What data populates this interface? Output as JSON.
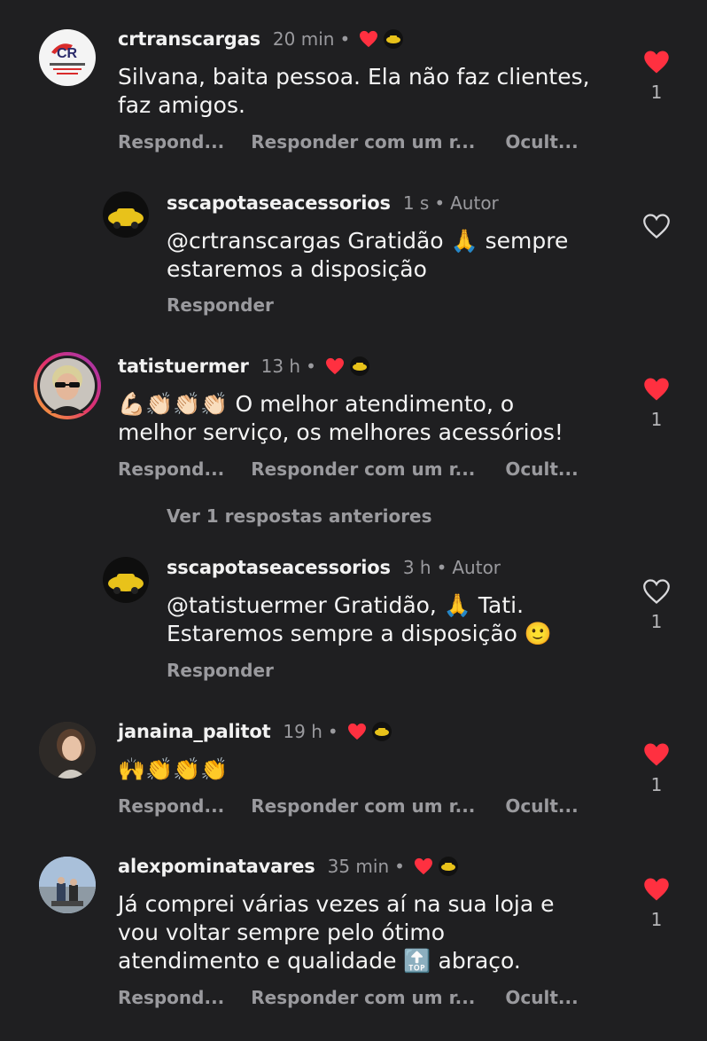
{
  "comments": [
    {
      "user": "crtranscargas",
      "time": "20 min",
      "dot": "•",
      "text": "Silvana, baita pessoa. Ela não faz clientes, faz amigos.",
      "line1": "Silvana, baita pessoa. Ela não faz clientes,",
      "line2": "faz amigos.",
      "reply": "Respond...",
      "reply_with": "Responder com um r...",
      "hide": "Ocult...",
      "likes": "1",
      "avatar_logo": "CR"
    },
    {
      "user": "sscapotaseacessorios",
      "time": "1 s",
      "dot": "•",
      "author": "Autor",
      "mention": "@crtranscargas",
      "line1_rest": " Gratidão 🙏 sempre",
      "line2": "estaremos a disposição",
      "reply": "Responder",
      "likes": ""
    },
    {
      "user": "tatistuermer",
      "time": "13 h",
      "dot": "•",
      "line1": "💪🏻👏🏻👏🏻👏🏻 O melhor atendimento, o",
      "line2": "melhor serviço, os melhores acessórios!",
      "reply": "Respond...",
      "reply_with": "Responder com um r...",
      "hide": "Ocult...",
      "likes": "1",
      "view_previous": "Ver 1 respostas anteriores"
    },
    {
      "user": "sscapotaseacessorios",
      "time": "3 h",
      "dot": "•",
      "author": "Autor",
      "mention": "@tatistuermer",
      "line1_rest": " Gratidão, 🙏 Tati.",
      "line2": "Estaremos sempre a disposição 🙂",
      "reply": "Responder",
      "likes": "1"
    },
    {
      "user": "janaina_palitot",
      "time": "19 h",
      "dot": "•",
      "line1": "🙌👏👏👏",
      "reply": "Respond...",
      "reply_with": "Responder com um r...",
      "hide": "Ocult...",
      "likes": "1"
    },
    {
      "user": "alexpominatavares",
      "time": "35 min",
      "dot": "•",
      "line1": "Já comprei várias vezes aí na sua loja e",
      "line2": "vou voltar sempre pelo ótimo",
      "line3": "atendimento e qualidade 🔝 abraço.",
      "reply": "Respond...",
      "reply_with": "Responder com um r...",
      "hide": "Ocult...",
      "likes": "1"
    }
  ],
  "colors": {
    "background": "#1f1f21",
    "heart_red": "#ff3040",
    "muted": "#9a9a9e"
  },
  "icons": [
    "heart-filled-icon",
    "heart-outline-icon"
  ]
}
